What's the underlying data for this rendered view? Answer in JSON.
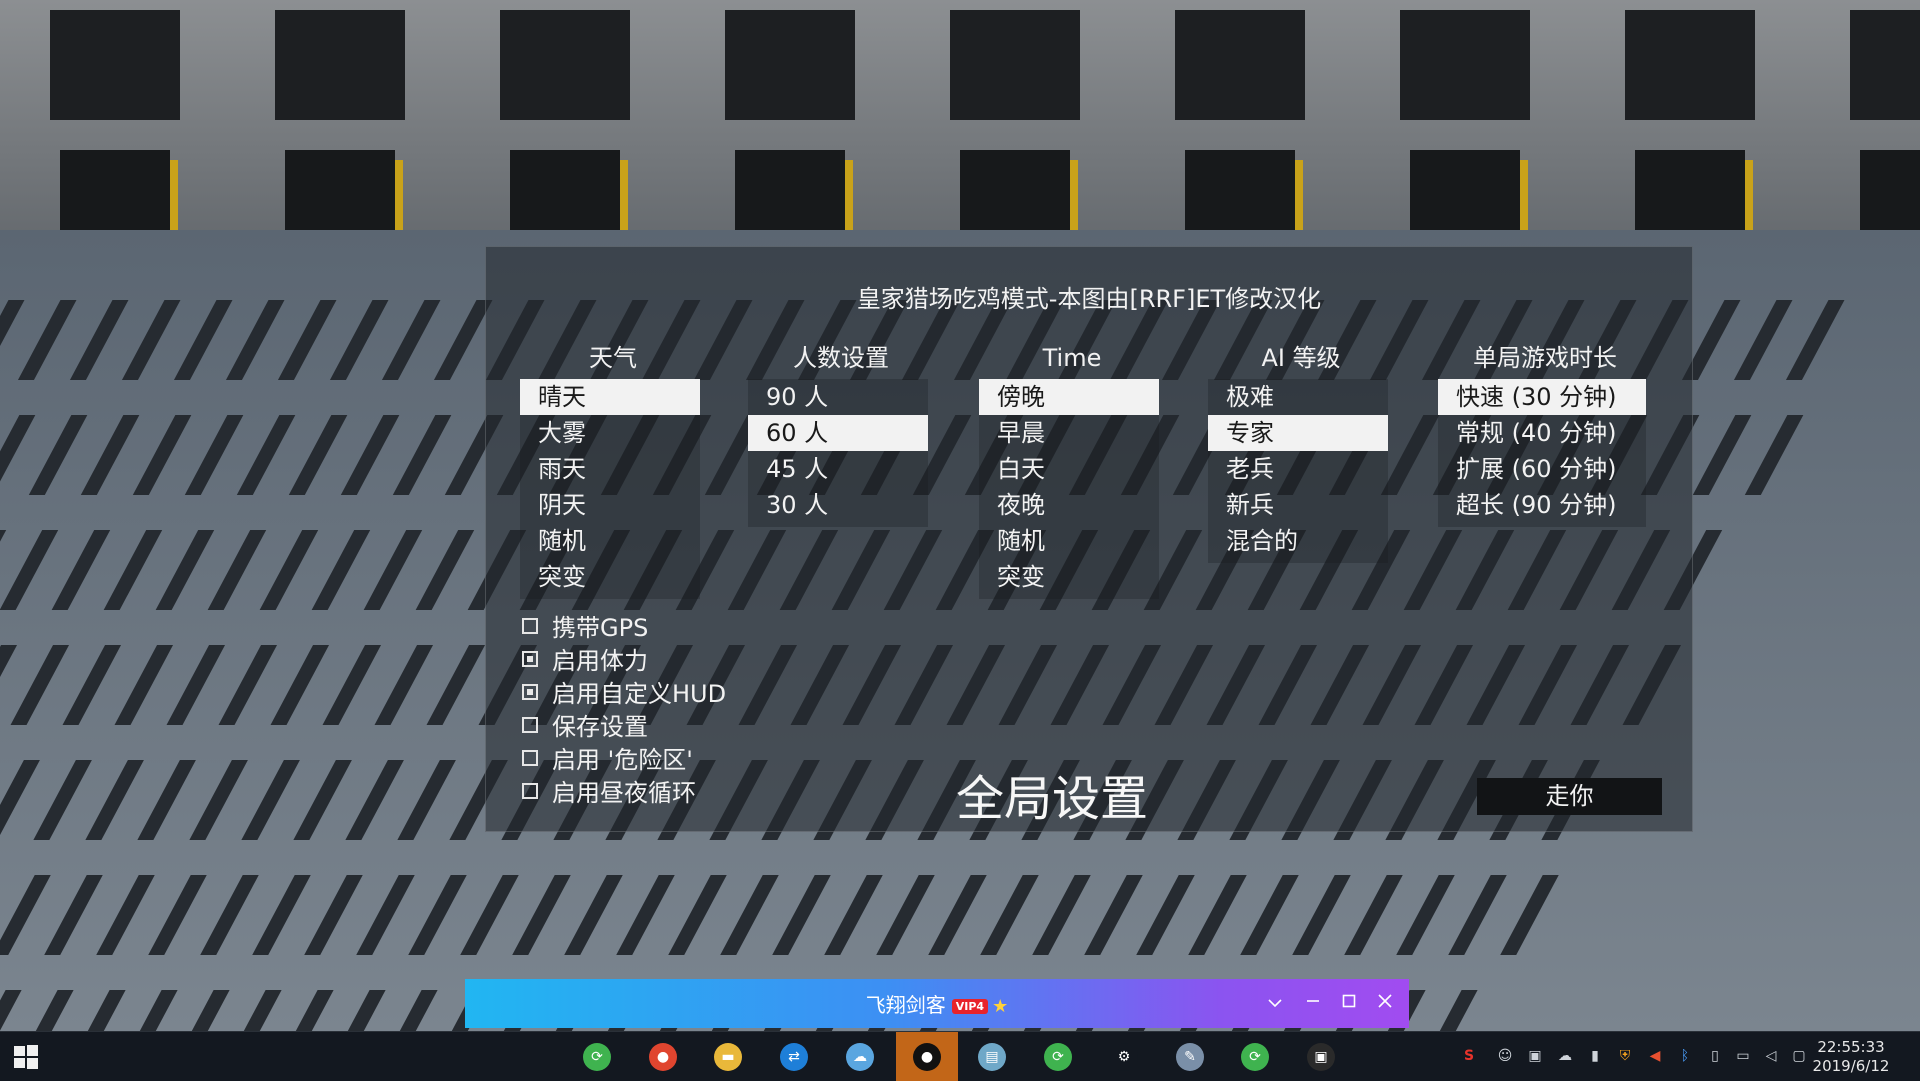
{
  "panel": {
    "title": "皇家猎场吃鸡模式-本图由[RRF]ET修改汉化",
    "columns": {
      "weather": {
        "header": "天气",
        "options": [
          "晴天",
          "大雾",
          "雨天",
          "阴天",
          "随机",
          "突变"
        ],
        "selected": 0
      },
      "players": {
        "header": "人数设置",
        "options": [
          "90 人",
          "60 人",
          "45 人",
          "30 人"
        ],
        "selected": 1
      },
      "time": {
        "header": "Time",
        "options": [
          "傍晚",
          "早晨",
          "白天",
          "夜晚",
          "随机",
          "突变"
        ],
        "selected": 0
      },
      "ai": {
        "header": "AI 等级",
        "options": [
          "极难",
          "专家",
          "老兵",
          "新兵",
          "混合的"
        ],
        "selected": 1
      },
      "length": {
        "header": "单局游戏时长",
        "options": [
          "快速 (30 分钟)",
          "常规 (40 分钟)",
          "扩展 (60 分钟)",
          "超长 (90 分钟)"
        ],
        "selected": 0
      }
    },
    "checkboxes": [
      {
        "label": "携带GPS",
        "checked": false
      },
      {
        "label": "启用体力",
        "checked": true
      },
      {
        "label": "启用自定义HUD",
        "checked": true
      },
      {
        "label": "保存设置",
        "checked": false
      },
      {
        "label": "启用 '危险区'",
        "checked": false
      },
      {
        "label": "启用昼夜循环",
        "checked": false
      }
    ],
    "global_title": "全局设置",
    "go_button": "走你"
  },
  "float_bar": {
    "title": "飞翔剑客",
    "badge": "VIP4",
    "star": "★"
  },
  "taskbar": {
    "apps": [
      {
        "name": "accelerator-green-icon",
        "glyph": "⟳",
        "color": "#3fb34f"
      },
      {
        "name": "chrome-icon",
        "glyph": "●",
        "color": "#e0452f"
      },
      {
        "name": "file-explorer-icon",
        "glyph": "▬",
        "color": "#e9b83a"
      },
      {
        "name": "teamviewer-icon",
        "glyph": "⇄",
        "color": "#1e7fd8"
      },
      {
        "name": "cloud-icon",
        "glyph": "☁",
        "color": "#5aa6e0"
      },
      {
        "name": "qq-penguin-icon",
        "glyph": "●",
        "color": "#111111"
      },
      {
        "name": "notes-icon",
        "glyph": "▤",
        "color": "#6fa8c8"
      },
      {
        "name": "accelerator-green-icon-2",
        "glyph": "⟳",
        "color": "#3fb34f"
      },
      {
        "name": "settings-gear-icon",
        "glyph": "⚙",
        "color": "#131820"
      },
      {
        "name": "paint-icon",
        "glyph": "✎",
        "color": "#7a8fa8"
      },
      {
        "name": "accelerator-green-icon-3",
        "glyph": "⟳",
        "color": "#3fb34f"
      },
      {
        "name": "game-icon",
        "glyph": "▣",
        "color": "#2a2a2a"
      }
    ],
    "active_app": 5,
    "clock_time": "22:55:33",
    "clock_date": "2019/6/12"
  }
}
